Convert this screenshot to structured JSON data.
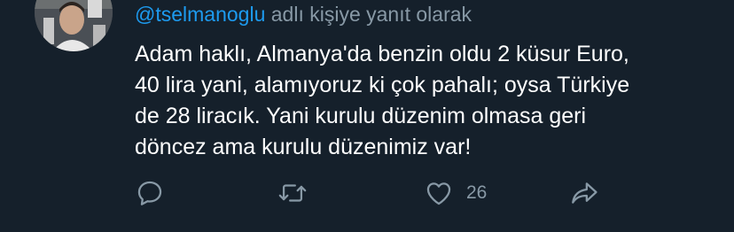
{
  "reply_context": {
    "username": "@tselmanoglu",
    "suffix": " adlı kişiye yanıt olarak"
  },
  "tweet": {
    "lines": [
      "Adam haklı, Almanya'da benzin oldu 2 küsur Euro,",
      "40 lira yani, alamıyoruz ki çok pahalı; oysa Türkiye",
      "de 28 liracık. Yani kurulu düzenim olmasa geri",
      "döncez ama kurulu düzenimiz var!"
    ]
  },
  "actions": {
    "reply_icon": "speech-bubble-icon",
    "retweet_icon": "retweet-arrows-icon",
    "like_icon": "heart-icon",
    "like_count": "26",
    "share_icon": "share-arrow-icon"
  },
  "colors": {
    "background": "#15202b",
    "mention": "#1d9bf0",
    "muted": "#8899a6",
    "text": "#ffffff"
  }
}
